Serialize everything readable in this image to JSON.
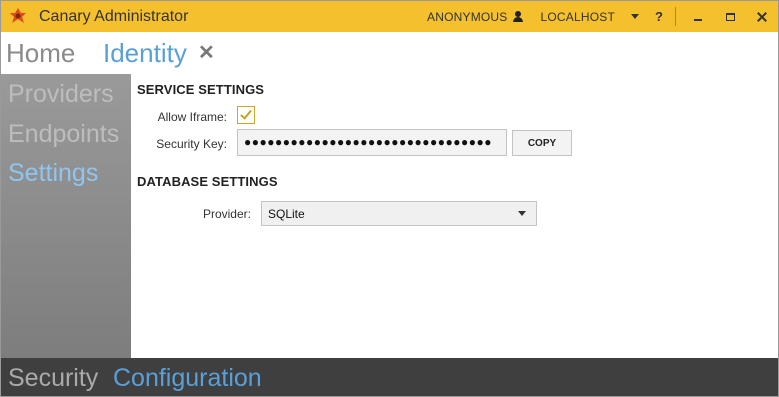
{
  "window": {
    "title": "Canary Administrator",
    "user_label": "ANONYMOUS",
    "server_label": "LOCALHOST",
    "help_label": "?"
  },
  "topnav": {
    "home_label": "Home",
    "identity_label": "Identity",
    "close_glyph": "✕"
  },
  "sidebar": {
    "items": [
      {
        "label": "Providers",
        "active": false
      },
      {
        "label": "Endpoints",
        "active": false
      },
      {
        "label": "Settings",
        "active": true
      }
    ]
  },
  "service_settings": {
    "heading": "SERVICE SETTINGS",
    "allow_iframe_label": "Allow Iframe:",
    "allow_iframe_checked": true,
    "security_key_label": "Security Key:",
    "security_key_value": "●●●●●●●●●●●●●●●●●●●●●●●●●●●●●●●●",
    "copy_label": "COPY"
  },
  "database_settings": {
    "heading": "DATABASE SETTINGS",
    "provider_label": "Provider:",
    "provider_value": "SQLite"
  },
  "bottombar": {
    "security_label": "Security",
    "configuration_label": "Configuration"
  },
  "colors": {
    "titlebar": "#f5c02d",
    "accent_blue": "#5aa0d8",
    "sidebar_active": "#8fc5f0",
    "bottombar": "#3f3f3f"
  }
}
